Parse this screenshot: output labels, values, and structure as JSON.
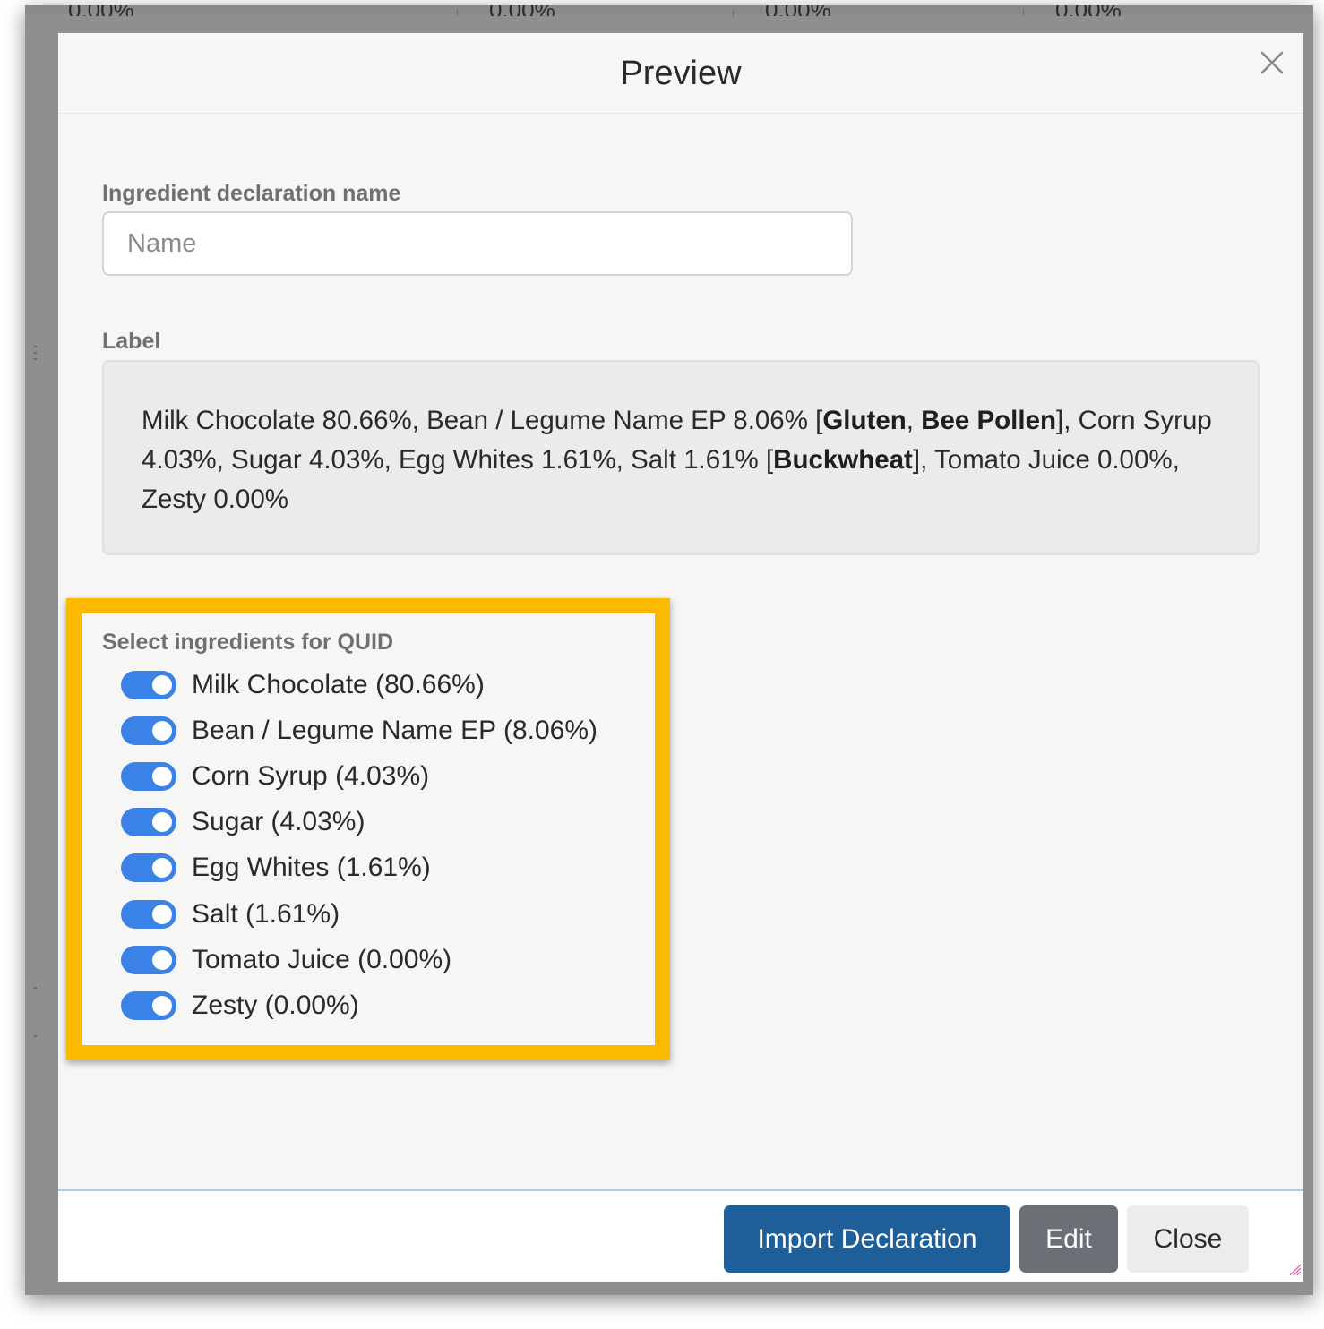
{
  "background": {
    "values": [
      "0.00%",
      "0.00%",
      "0.00%",
      "0.00%"
    ]
  },
  "modal": {
    "title": "Preview",
    "close_icon": "close-icon"
  },
  "declaration_name": {
    "label": "Ingredient declaration name",
    "value": "",
    "placeholder": "Name"
  },
  "label_section": {
    "heading": "Label",
    "segments": [
      {
        "text": "Milk Chocolate 80.66%, Bean / Legume Name EP 8.06% [",
        "bold": false
      },
      {
        "text": "Gluten",
        "bold": true
      },
      {
        "text": ", ",
        "bold": false
      },
      {
        "text": "Bee Pollen",
        "bold": true
      },
      {
        "text": "], Corn Syrup 4.03%, Sugar 4.03%, Egg Whites 1.61%, Salt 1.61% [",
        "bold": false
      },
      {
        "text": "Buckwheat",
        "bold": true
      },
      {
        "text": "], Tomato Juice 0.00%, Zesty 0.00%",
        "bold": false
      }
    ]
  },
  "quid": {
    "title": "Select ingredients for QUID",
    "highlight_color": "#fbb900",
    "toggle_color": "#3b82e8",
    "items": [
      {
        "label": "Milk Chocolate (80.66%)",
        "enabled": true
      },
      {
        "label": "Bean / Legume Name EP (8.06%)",
        "enabled": true
      },
      {
        "label": "Corn Syrup (4.03%)",
        "enabled": true
      },
      {
        "label": "Sugar (4.03%)",
        "enabled": true
      },
      {
        "label": "Egg Whites (1.61%)",
        "enabled": true
      },
      {
        "label": "Salt (1.61%)",
        "enabled": true
      },
      {
        "label": "Tomato Juice (0.00%)",
        "enabled": true
      },
      {
        "label": "Zesty (0.00%)",
        "enabled": true
      }
    ]
  },
  "footer": {
    "import_label": "Import Declaration",
    "edit_label": "Edit",
    "close_label": "Close",
    "import_color": "#1f5f99",
    "edit_color": "#6b7077"
  }
}
